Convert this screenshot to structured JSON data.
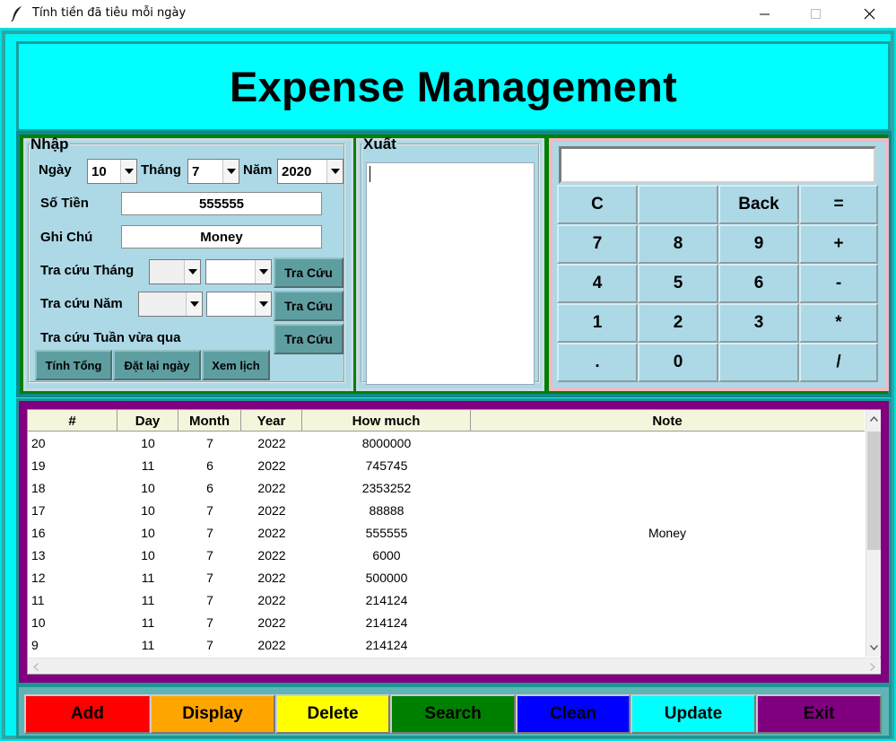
{
  "window": {
    "title": "Tính tiền đã tiêu mỗi ngày",
    "controls": {
      "minimize": "—",
      "maximize": "☐",
      "close": "✕"
    },
    "title_icon": "feather-icon"
  },
  "header": {
    "title": "Expense Management"
  },
  "input": {
    "legend": "Nhập",
    "day_label": "Ngày",
    "day_value": "10",
    "month_label": "Tháng",
    "month_value": "7",
    "year_label": "Năm",
    "year_value": "2020",
    "amount_label": "Số Tiền",
    "amount_value": "555555",
    "note_label": "Ghi Chú",
    "note_value": "Money",
    "lookup_month_label": "Tra cứu Tháng",
    "lookup_year_label": "Tra cứu Năm",
    "lookup_week_label": "Tra cứu Tuần vừa qua",
    "lookup_button": "Tra Cứu",
    "sum_button": "Tính Tổng",
    "reset_button": "Đặt lại ngày",
    "calendar_button": "Xem lịch"
  },
  "output": {
    "legend": "Xuất"
  },
  "calculator": {
    "display_value": "",
    "keys": [
      "C",
      "",
      "Back",
      "=",
      "7",
      "8",
      "9",
      "+",
      "4",
      "5",
      "6",
      "-",
      "1",
      "2",
      "3",
      "*",
      ".",
      "0",
      "",
      "/"
    ]
  },
  "table": {
    "columns": [
      "#",
      "Day",
      "Month",
      "Year",
      "How much",
      "Note"
    ],
    "rows": [
      [
        "20",
        "10",
        "7",
        "2022",
        "8000000",
        ""
      ],
      [
        "19",
        "11",
        "6",
        "2022",
        "745745",
        ""
      ],
      [
        "18",
        "10",
        "6",
        "2022",
        "2353252",
        ""
      ],
      [
        "17",
        "10",
        "7",
        "2022",
        "88888",
        ""
      ],
      [
        "16",
        "10",
        "7",
        "2022",
        "555555",
        "Money"
      ],
      [
        "13",
        "10",
        "7",
        "2022",
        "6000",
        ""
      ],
      [
        "12",
        "11",
        "7",
        "2022",
        "500000",
        ""
      ],
      [
        "11",
        "11",
        "7",
        "2022",
        "214124",
        ""
      ],
      [
        "10",
        "11",
        "7",
        "2022",
        "214124",
        ""
      ],
      [
        "9",
        "11",
        "7",
        "2022",
        "214124",
        ""
      ]
    ]
  },
  "actions": [
    {
      "label": "Add",
      "bg": "#ff0000",
      "fg": "#000000"
    },
    {
      "label": "Display",
      "bg": "#ffa500",
      "fg": "#000000"
    },
    {
      "label": "Delete",
      "bg": "#ffff00",
      "fg": "#000000"
    },
    {
      "label": "Search",
      "bg": "#008000",
      "fg": "#000000"
    },
    {
      "label": "Clean",
      "bg": "#0000ff",
      "fg": "#000000"
    },
    {
      "label": "Update",
      "bg": "#00ffff",
      "fg": "#000000"
    },
    {
      "label": "Exit",
      "bg": "#800080",
      "fg": "#000000"
    }
  ],
  "colors": {
    "header_bg": "#00ffff",
    "top_section_bg": "#008000",
    "panel_bg": "#add8e6",
    "table_section_bg": "#800080",
    "teal_button": "#5f9ea0",
    "table_header_bg": "#f5f5dc"
  }
}
